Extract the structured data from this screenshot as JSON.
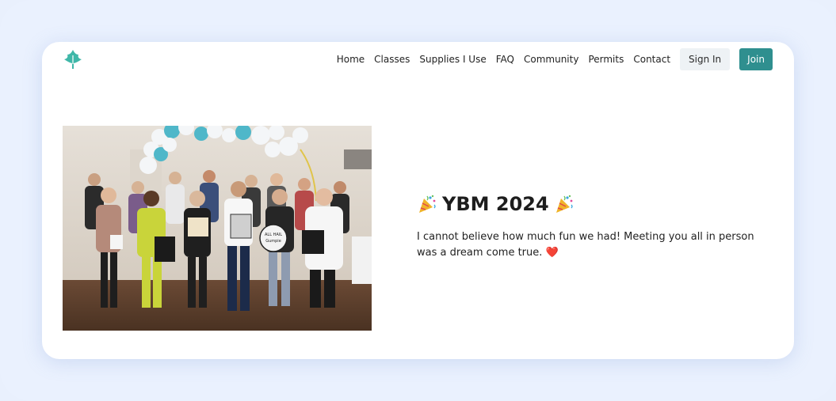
{
  "nav": {
    "items": [
      {
        "label": "Home"
      },
      {
        "label": "Classes"
      },
      {
        "label": "Supplies I Use"
      },
      {
        "label": "FAQ"
      },
      {
        "label": "Community"
      },
      {
        "label": "Permits"
      },
      {
        "label": "Contact"
      }
    ],
    "signin_label": "Sign In",
    "join_label": "Join"
  },
  "event": {
    "title": "YBM 2024",
    "description": "I cannot believe how much fun we had! Meeting you all in person was a dream come true.",
    "heart": "❤️"
  },
  "photo": {
    "sign_text": "ALL HAIL Gumpie"
  },
  "icons": {
    "logo": "leaf-logo-icon",
    "party_left": "party-popper-icon",
    "party_right": "party-popper-icon",
    "heart": "heart-icon"
  },
  "colors": {
    "brand": "#2f8f8f",
    "logo": "#3fb7a8",
    "page_bg": "#eaf1fe",
    "card_bg": "#ffffff",
    "signin_bg": "#eef2f5"
  }
}
